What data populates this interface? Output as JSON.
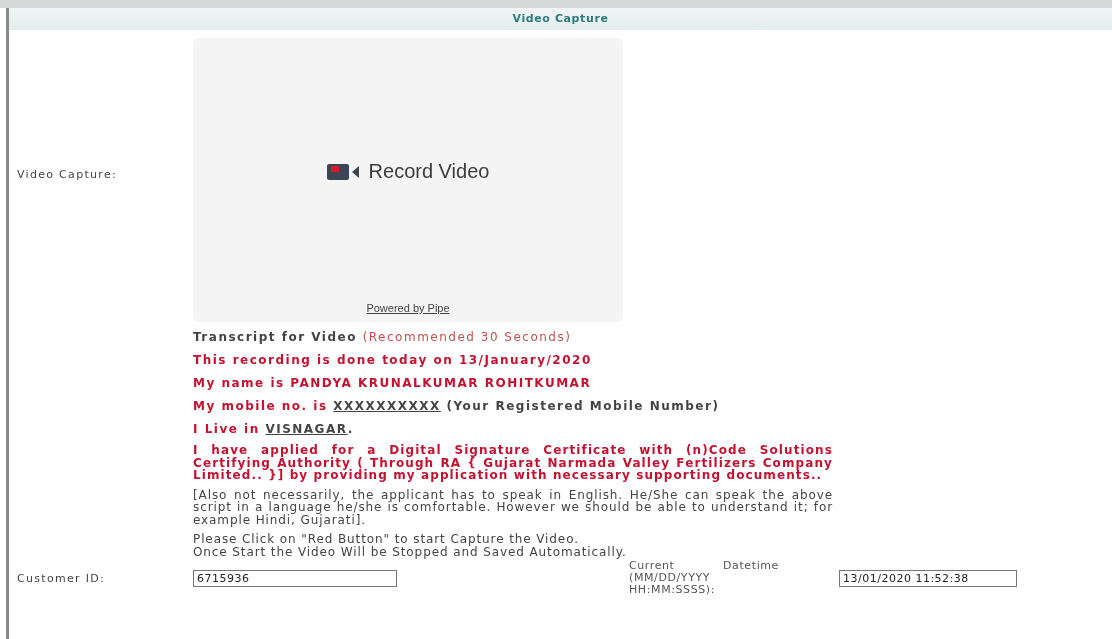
{
  "header": {
    "title": "Video Capture"
  },
  "video_capture": {
    "label": "Video Capture:",
    "record_button": "Record Video",
    "powered_by": "Powered by Pipe"
  },
  "transcript": {
    "title": "Transcript for Video",
    "hint": "(Recommended 30 Seconds)",
    "lines": [
      {
        "parts": [
          {
            "text": "This recording is done today on 13/January/2020",
            "kind": "red"
          }
        ]
      },
      {
        "parts": [
          {
            "text": "My name is PANDYA KRUNALKUMAR ROHITKUMAR",
            "kind": "red"
          }
        ]
      },
      {
        "parts": [
          {
            "text": "My mobile no. is ",
            "kind": "red"
          },
          {
            "text": "XXXXXXXXXX",
            "kind": "underline"
          },
          {
            "text": " (Your Registered Mobile Number)",
            "kind": "dark"
          }
        ]
      },
      {
        "parts": [
          {
            "text": "I Live in ",
            "kind": "red"
          },
          {
            "text": "VISNAGAR",
            "kind": "underline"
          },
          {
            "text": ".",
            "kind": "dark"
          }
        ]
      }
    ],
    "statement": "I have applied for a Digital Signature Certificate with (n)Code Solutions Certifying Authority ( Through RA { Gujarat Narmada Valley Fertilizers Company Limited.. }] by providing my application with necessary supporting documents..",
    "note": "[Also not necessarily, the applicant has to speak in English. He/She can speak the above script in a language he/she is comfortable. However we should be able to understand it; for example Hindi, Gujarati].",
    "instructions": [
      "Please Click on \"Red Button\" to start Capture the Video.",
      "Once Start the Video Will be Stopped and Saved Automatically."
    ]
  },
  "customer_id": {
    "label": "Customer ID:",
    "value": "6715936"
  },
  "datetime": {
    "label": "Current Datetime (MM/DD/YYYY HH:MM:SSSS):",
    "value": "13/01/2020 11:52:38"
  }
}
